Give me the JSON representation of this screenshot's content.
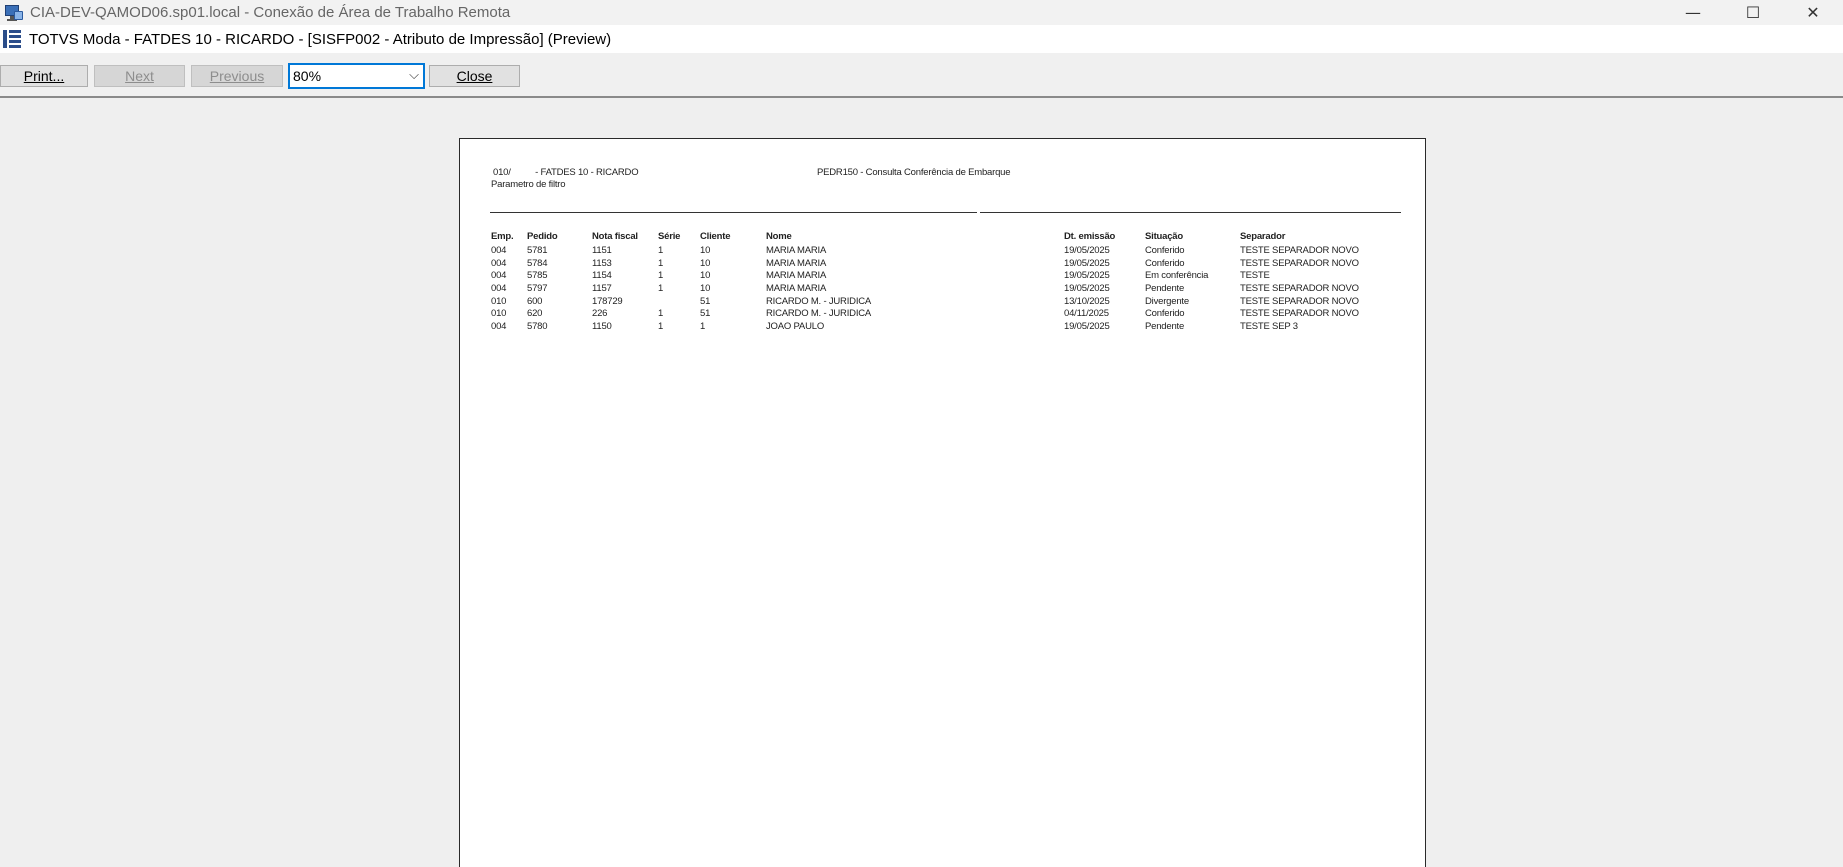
{
  "rdp": {
    "title": "CIA-DEV-QAMOD06.sp01.local - Conexão de Área de Trabalho Remota",
    "minimize": "—",
    "maximize": "☐",
    "close": "✕"
  },
  "app": {
    "title": "TOTVS Moda - FATDES 10 - RICARDO - [SISFP002 - Atributo de Impressão] (Preview)"
  },
  "toolbar": {
    "print_label": "Print...",
    "next_label": "Next",
    "previous_label": "Previous",
    "zoom_value": "80%",
    "close_label": "Close"
  },
  "report": {
    "header_left": "010/          - FATDES 10 - RICARDO",
    "header_center": "PEDR150 - Consulta Conferência de Embarque",
    "filter_label": "Parametro de filtro",
    "columns": [
      "Emp.",
      "Pedido",
      "Nota fiscal",
      "Série",
      "Cliente",
      "Nome",
      "Dt. emissão",
      "Situação",
      "Separador"
    ],
    "rows": [
      [
        "004",
        "5781",
        "1151",
        "1",
        "10",
        "MARIA MARIA",
        "19/05/2025",
        "Conferido",
        "TESTE SEPARADOR NOVO"
      ],
      [
        "004",
        "5784",
        "1153",
        "1",
        "10",
        "MARIA MARIA",
        "19/05/2025",
        "Conferido",
        "TESTE SEPARADOR NOVO"
      ],
      [
        "004",
        "5785",
        "1154",
        "1",
        "10",
        "MARIA MARIA",
        "19/05/2025",
        "Em conferência",
        "TESTE"
      ],
      [
        "004",
        "5797",
        "1157",
        "1",
        "10",
        "MARIA MARIA",
        "19/05/2025",
        "Pendente",
        "TESTE SEPARADOR NOVO"
      ],
      [
        "010",
        "600",
        "178729",
        "",
        "51",
        "RICARDO M. - JURIDICA",
        "13/10/2025",
        "Divergente",
        "TESTE SEPARADOR NOVO"
      ],
      [
        "010",
        "620",
        "226",
        "1",
        "51",
        "RICARDO M. - JURIDICA",
        "04/11/2025",
        "Conferido",
        "TESTE SEPARADOR NOVO"
      ],
      [
        "004",
        "5780",
        "1150",
        "1",
        "1",
        "JOAO PAULO",
        "19/05/2025",
        "Pendente",
        "TESTE SEP 3"
      ]
    ]
  }
}
